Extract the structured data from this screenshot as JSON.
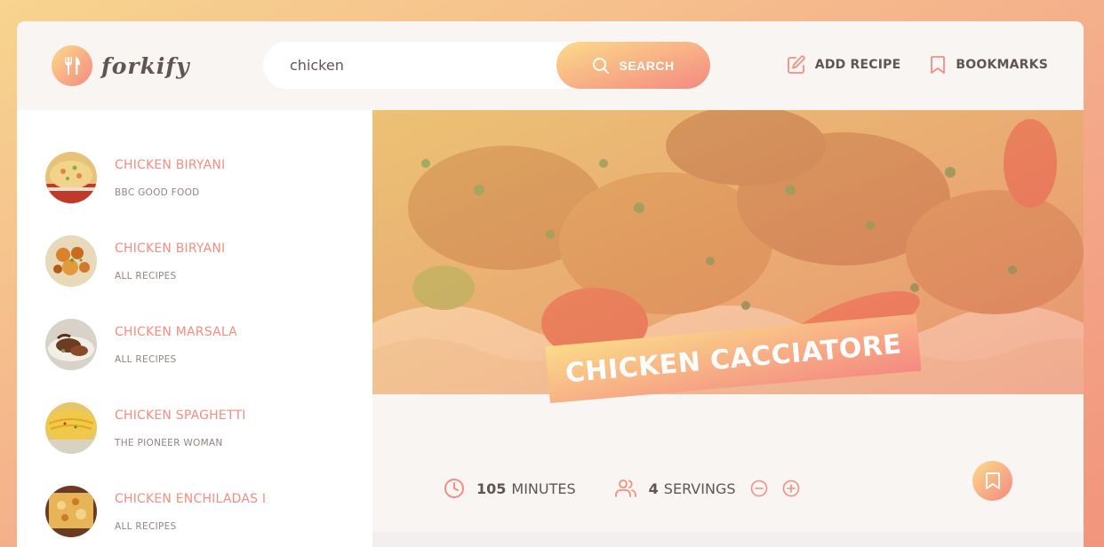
{
  "app": {
    "logo_text": "forkify"
  },
  "search": {
    "value": "chicken",
    "button_label": "Search"
  },
  "nav": {
    "add_recipe": "ADD RECIPE",
    "bookmarks": "BOOKMARKS"
  },
  "results": [
    {
      "title": "CHICKEN BIRYANI",
      "publisher": "BBC GOOD FOOD"
    },
    {
      "title": "CHICKEN BIRYANI",
      "publisher": "ALL RECIPES"
    },
    {
      "title": "CHICKEN MARSALA",
      "publisher": "ALL RECIPES"
    },
    {
      "title": "CHICKEN SPAGHETTI",
      "publisher": "THE PIONEER WOMAN"
    },
    {
      "title": "CHICKEN ENCHILADAS I",
      "publisher": "ALL RECIPES"
    }
  ],
  "recipe": {
    "title": "CHICKEN CACCIATORE",
    "minutes": "105",
    "minutes_label": "MINUTES",
    "servings": "4",
    "servings_label": "SERVINGS"
  },
  "icons": {
    "logo": "fork-knife-icon",
    "search": "search-icon",
    "add_recipe": "edit-icon",
    "bookmarks": "bookmark-icon",
    "clock": "clock-icon",
    "users": "users-icon",
    "minus": "minus-circle-icon",
    "plus": "plus-circle-icon"
  },
  "colors": {
    "accent_start": "#fbdb89",
    "accent_end": "#f48982",
    "title_color": "#f38e82",
    "text_dark": "#615551",
    "text_muted": "#918581",
    "bg_light": "#f9f5f3"
  }
}
